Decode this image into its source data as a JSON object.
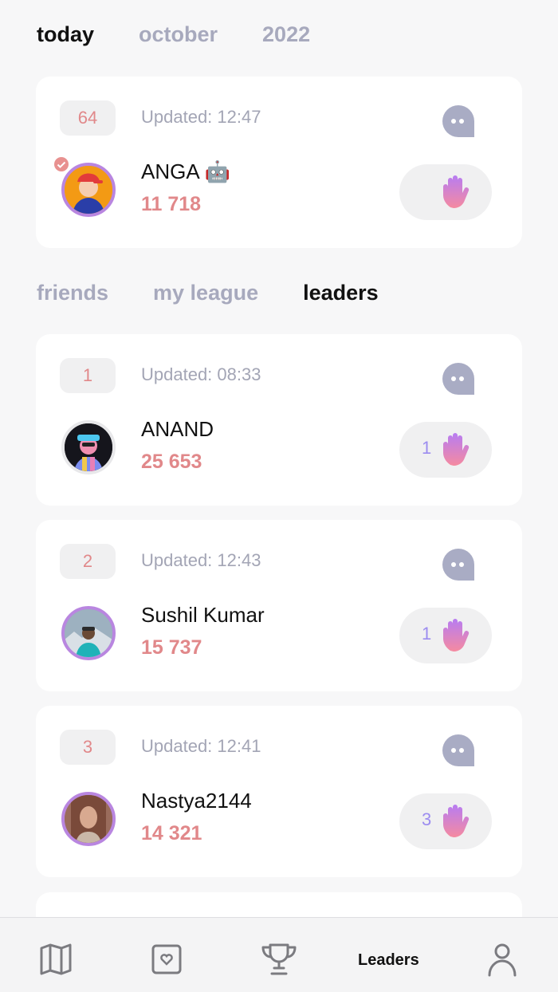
{
  "period_tabs": [
    {
      "label": "today",
      "active": true
    },
    {
      "label": "october",
      "active": false
    },
    {
      "label": "2022",
      "active": false
    }
  ],
  "section_tabs": [
    {
      "label": "friends",
      "active": false
    },
    {
      "label": "my league",
      "active": false
    },
    {
      "label": "leaders",
      "active": true
    }
  ],
  "my_card": {
    "rank": "64",
    "updated": "Updated: 12:47",
    "name": "ANGA 🤖",
    "score": "11 718",
    "waves": ""
  },
  "leaders": [
    {
      "rank": "1",
      "updated": "Updated: 08:33",
      "name": "ANAND",
      "score": "25 653",
      "waves": "1"
    },
    {
      "rank": "2",
      "updated": "Updated: 12:43",
      "name": "Sushil Kumar",
      "score": "15 737",
      "waves": "1"
    },
    {
      "rank": "3",
      "updated": "Updated: 12:41",
      "name": "Nastya2144",
      "score": "14 321",
      "waves": "3"
    }
  ],
  "bottom_nav": {
    "items": [
      "map-icon",
      "heart-card-icon",
      "trophy-icon",
      "Leaders",
      "profile-icon"
    ],
    "active_label": "Leaders"
  },
  "colors": {
    "accent_score": "#e1888a",
    "wave_count": "#9c8cf0",
    "chat_icon": "#a9acc4",
    "avatar_ring": "#b986e0"
  }
}
